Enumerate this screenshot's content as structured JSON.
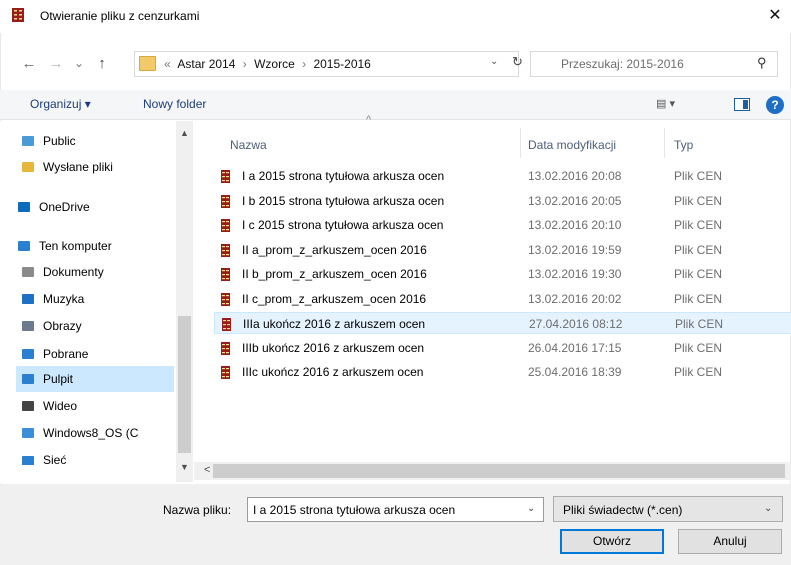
{
  "window": {
    "title": "Otwieranie pliku z cenzurkami",
    "close_glyph": "✕"
  },
  "address": {
    "back_glyph": "←",
    "forward_glyph": "→",
    "recent_glyph": "⌄",
    "up_glyph": "↑",
    "overflow": "«",
    "crumbs": [
      "Astar 2014",
      "Wzorce",
      "2015-2016"
    ],
    "separator": "›",
    "dropdown_glyph": "⌄",
    "refresh_glyph": "↻"
  },
  "search": {
    "placeholder": "Przeszukaj: 2015-2016",
    "icon_glyph": "⚲"
  },
  "toolbar": {
    "organize_label": "Organizuj ▾",
    "new_folder_label": "Nowy folder",
    "view_glyph": "▤ ▾",
    "help_glyph": "?"
  },
  "nav": {
    "items": [
      {
        "label": "Public",
        "icon": "public-folder-icon",
        "color": "#4a9ad6"
      },
      {
        "label": "Wysłane pliki",
        "icon": "sent-files-icon",
        "color": "#e6b73a"
      },
      {
        "label": "OneDrive",
        "icon": "cloud-icon",
        "color": "#0f6cbd"
      },
      {
        "label": "Ten komputer",
        "icon": "computer-icon",
        "color": "#2b7fd1"
      },
      {
        "label": "Dokumenty",
        "icon": "documents-icon",
        "color": "#8a8a8a"
      },
      {
        "label": "Muzyka",
        "icon": "music-icon",
        "color": "#1d70c4"
      },
      {
        "label": "Obrazy",
        "icon": "pictures-icon",
        "color": "#6b7a8f"
      },
      {
        "label": "Pobrane",
        "icon": "downloads-icon",
        "color": "#2b7fd1"
      },
      {
        "label": "Pulpit",
        "icon": "desktop-icon",
        "color": "#2b7fd1"
      },
      {
        "label": "Wideo",
        "icon": "video-icon",
        "color": "#444444"
      },
      {
        "label": "Windows8_OS (C",
        "icon": "drive-icon",
        "color": "#3b8fd9"
      },
      {
        "label": "Sieć",
        "icon": "network-icon",
        "color": "#2b7fd1"
      }
    ],
    "selected_index": 8,
    "scroll_up": "▲",
    "scroll_down": "▼"
  },
  "files": {
    "columns": [
      "Nazwa",
      "Data modyfikacji",
      "Typ"
    ],
    "sort_glyph": "^",
    "rows": [
      {
        "name": "I a 2015 strona tytułowa arkusza ocen",
        "date": "13.02.2016 20:08",
        "type": "Plik CEN"
      },
      {
        "name": "I b 2015 strona tytułowa arkusza ocen",
        "date": "13.02.2016 20:05",
        "type": "Plik CEN"
      },
      {
        "name": "I c 2015 strona tytułowa arkusza ocen",
        "date": "13.02.2016 20:10",
        "type": "Plik CEN"
      },
      {
        "name": "II a_prom_z_arkuszem_ocen 2016",
        "date": "13.02.2016 19:59",
        "type": "Plik CEN"
      },
      {
        "name": "II b_prom_z_arkuszem_ocen 2016",
        "date": "13.02.2016 19:30",
        "type": "Plik CEN"
      },
      {
        "name": "II c_prom_z_arkuszem_ocen 2016",
        "date": "13.02.2016 20:02",
        "type": "Plik CEN"
      },
      {
        "name": "IIIa ukończ 2016 z arkuszem ocen",
        "date": "27.04.2016 08:12",
        "type": "Plik CEN"
      },
      {
        "name": "IIIb ukończ 2016 z arkuszem ocen",
        "date": "26.04.2016 17:15",
        "type": "Plik CEN"
      },
      {
        "name": "IIIc ukończ 2016 z arkuszem ocen",
        "date": "25.04.2016 18:39",
        "type": "Plik CEN"
      }
    ],
    "selected_index": 6,
    "hscroll_left": "<",
    "hscroll_right": ">"
  },
  "footer": {
    "name_label": "Nazwa pliku:",
    "name_value": "I a 2015 strona tytułowa arkusza ocen",
    "name_dropdown_glyph": "⌄",
    "filter_value": "Pliki świadectw (*.cen)",
    "filter_dropdown_glyph": "⌄",
    "open_label": "Otwórz",
    "cancel_label": "Anuluj"
  },
  "colors": {
    "file_icon": "#9b1b1b",
    "selection": "#cce8ff",
    "accent": "#0078d7"
  }
}
